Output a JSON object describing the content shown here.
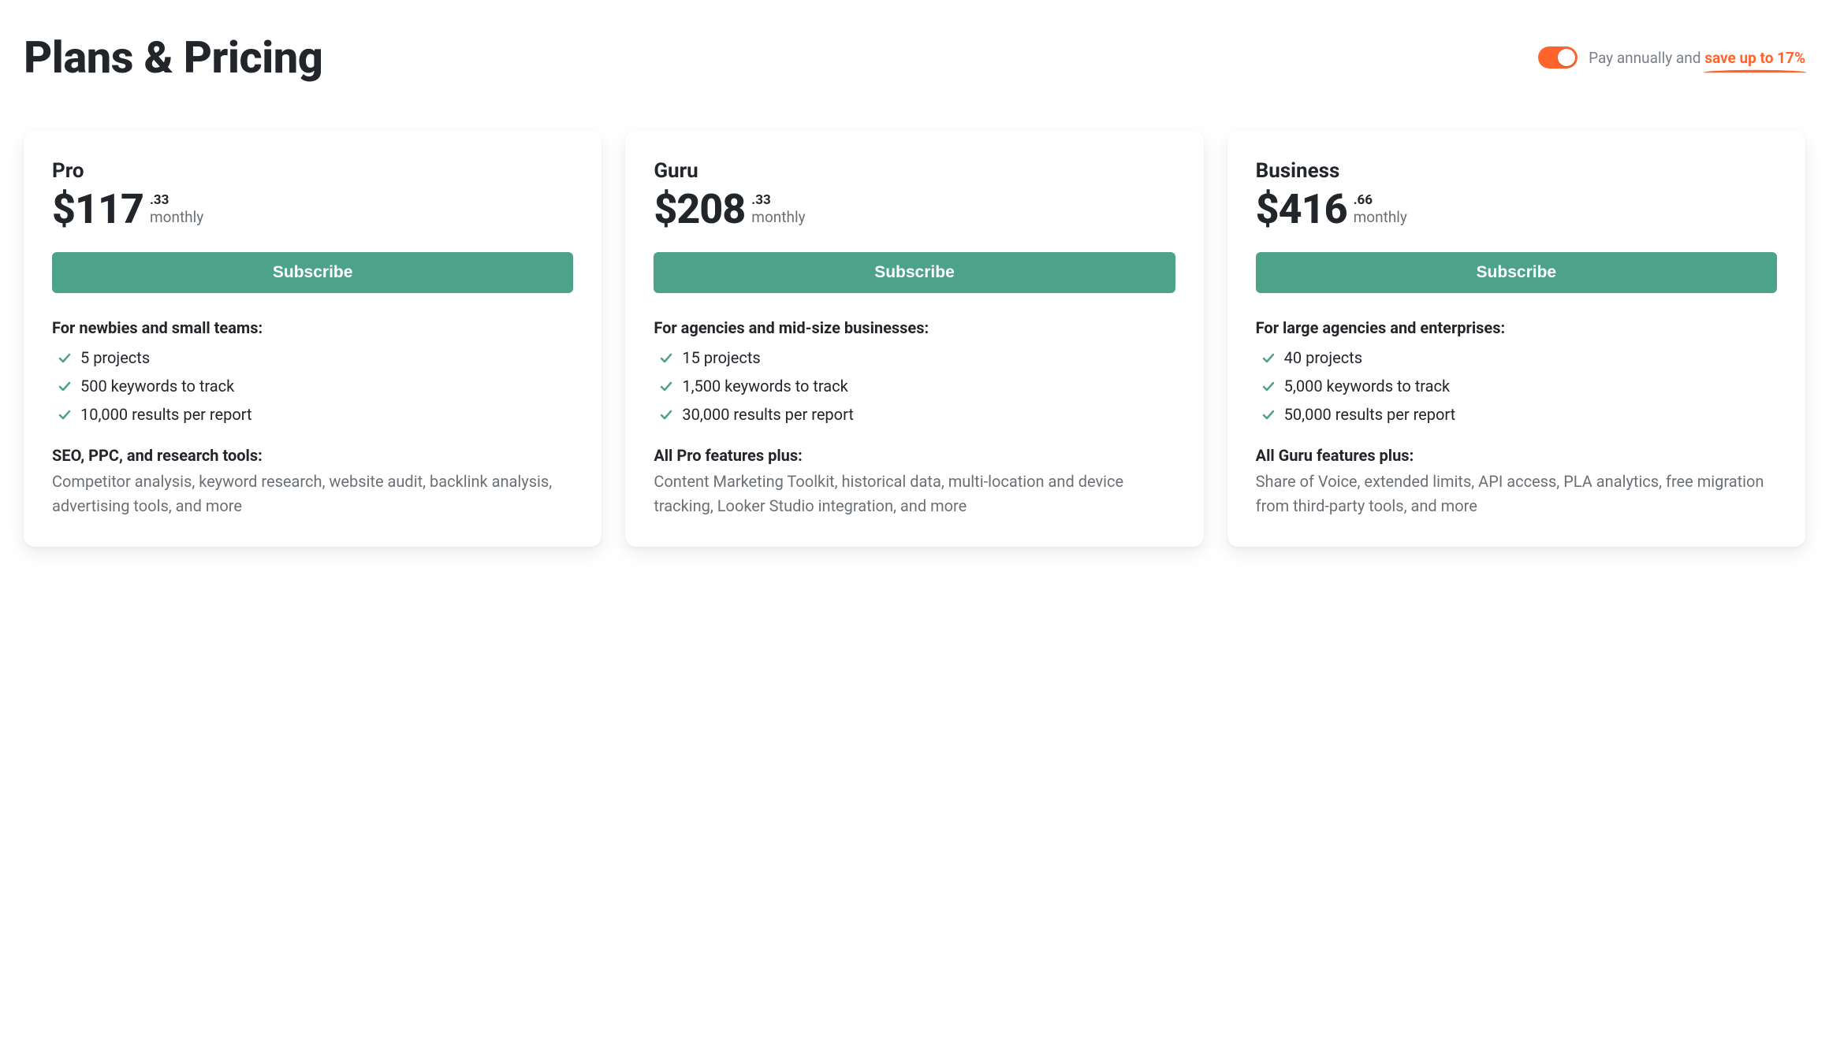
{
  "header": {
    "title": "Plans & Pricing",
    "toggle_prefix": "Pay annually and ",
    "toggle_highlight": "save up to 17%"
  },
  "plans": [
    {
      "name": "Pro",
      "price_main": "$117",
      "price_cents": ".33",
      "price_period": "monthly",
      "cta": "Subscribe",
      "audience": "For newbies and small teams:",
      "features": [
        "5 projects",
        "500 keywords to track",
        "10,000 results per report"
      ],
      "extras_heading": "SEO, PPC, and research tools:",
      "extras_body": "Competitor analysis, keyword research, website audit, backlink analysis, advertising tools, and more"
    },
    {
      "name": "Guru",
      "price_main": "$208",
      "price_cents": ".33",
      "price_period": "monthly",
      "cta": "Subscribe",
      "audience": "For agencies and mid-size businesses:",
      "features": [
        "15 projects",
        "1,500 keywords to track",
        "30,000 results per report"
      ],
      "extras_heading": "All Pro features plus:",
      "extras_body": "Content Marketing Toolkit, historical data, multi-location and device tracking, Looker Studio integration, and more"
    },
    {
      "name": "Business",
      "price_main": "$416",
      "price_cents": ".66",
      "price_period": "monthly",
      "cta": "Subscribe",
      "audience": "For large agencies and enterprises:",
      "features": [
        "40 projects",
        "5,000 keywords to track",
        "50,000 results per report"
      ],
      "extras_heading": "All Guru features plus:",
      "extras_body": "Share of Voice, extended limits, API access, PLA analytics, free migration from third-party tools, and more"
    }
  ]
}
